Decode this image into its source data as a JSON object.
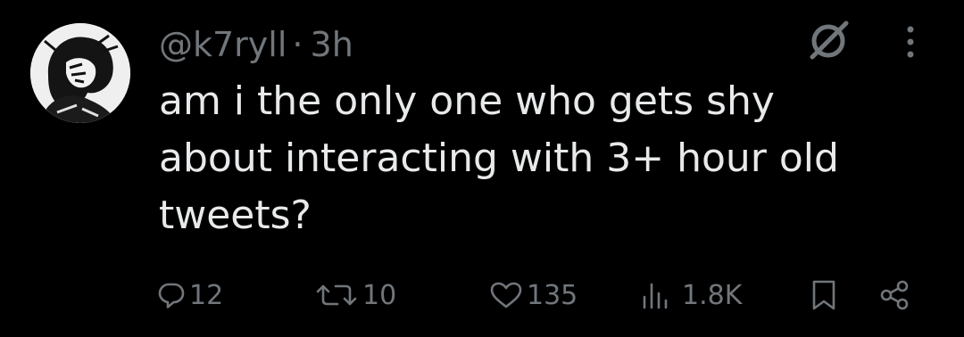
{
  "post": {
    "handle": "@k7ryll",
    "separator": "·",
    "time": "3h",
    "text": "am i the only one who gets shy\nabout interacting with 3+ hour old\ntweets?"
  },
  "actions": {
    "replies": "12",
    "reposts": "10",
    "likes": "135",
    "views": "1.8K"
  },
  "icons": {
    "grok": "grok-icon",
    "more": "more-vertical-icon",
    "reply": "reply-icon",
    "repost": "repost-icon",
    "like": "heart-icon",
    "views": "views-icon",
    "bookmark": "bookmark-icon",
    "share": "share-icon"
  },
  "colors": {
    "background": "#000000",
    "text": "#e7e9ea",
    "secondary": "#71767b"
  }
}
